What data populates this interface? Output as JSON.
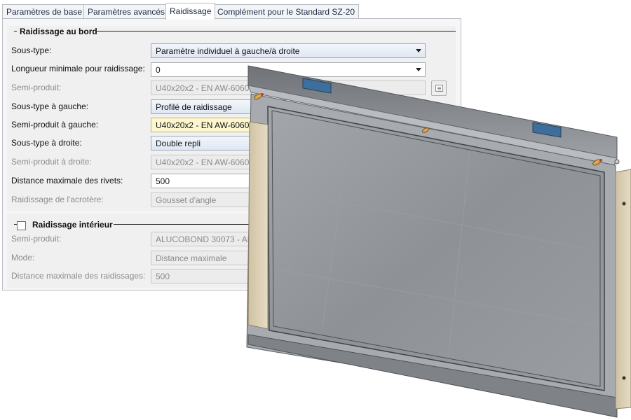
{
  "tabs": [
    {
      "label": "Paramètres de base",
      "active": false
    },
    {
      "label": "Paramètres avancés",
      "active": false
    },
    {
      "label": "Raidissage",
      "active": true
    },
    {
      "label": "Complément pour le Standard SZ-20",
      "active": false
    }
  ],
  "edge_group": {
    "title": "Raidissage au bord",
    "collapse_marker": "–",
    "rows": [
      {
        "label": "Sous-type:",
        "value": "Paramètre individuel à gauche/à droite"
      },
      {
        "label": "Longueur minimale pour raidissage:",
        "value": "0"
      },
      {
        "label": "Semi-produit:",
        "value": "U40x20x2 - EN AW-6060"
      },
      {
        "label": "Sous-type à gauche:",
        "value": "Profilé de raidissage"
      },
      {
        "label": "Semi-produit à gauche:",
        "value": "U40x20x2 - EN AW-6060"
      },
      {
        "label": "Sous-type à droite:",
        "value": "Double repli"
      },
      {
        "label": "Semi-produit à droite:",
        "value": "U40x20x2 - EN AW-6060"
      },
      {
        "label": "Distance maximale des rivets:",
        "value": "500"
      },
      {
        "label": "Raidissage de l'acrotère:",
        "value": "Gousset d'angle"
      }
    ]
  },
  "inner_group": {
    "title": "Raidissage intérieur",
    "checked": false,
    "rows": [
      {
        "label": "Semi-produit:",
        "value": "ALUCOBOND 30073 - AL"
      },
      {
        "label": "Mode:",
        "value": "Distance maximale"
      },
      {
        "label": "Distance maximale des raidissages:",
        "value": "500"
      }
    ]
  },
  "colors": {
    "frame_gray": "#8e9095",
    "glass": "#8f9296",
    "stiffener_beige": "#d8ccb0",
    "clip_blue": "#3e6f9c"
  }
}
